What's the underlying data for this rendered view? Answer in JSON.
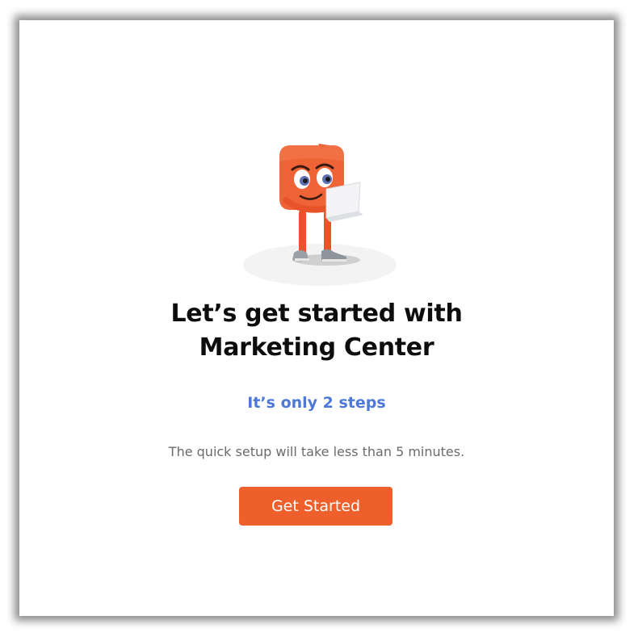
{
  "dialog": {
    "title_line1": "Let’s get started with",
    "title_line2": "Marketing Center",
    "subtitle": "It’s only 2 steps",
    "description": "The quick setup will take less than 5 minutes.",
    "primary_button_label": "Get Started"
  },
  "mascot": {
    "icon": "mascot-with-laptop-illustration"
  },
  "colors": {
    "accent": "#ee5f2b",
    "subtitle": "#4e78d8",
    "title": "#0d0d0d",
    "description": "#6b6b6b",
    "background": "#ffffff"
  }
}
